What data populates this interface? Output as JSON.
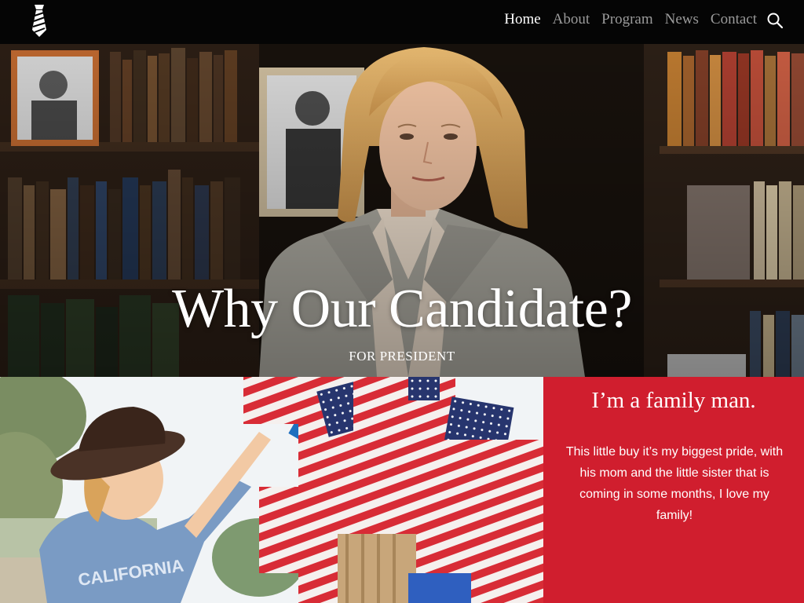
{
  "nav": {
    "items": [
      {
        "label": "Home",
        "active": true
      },
      {
        "label": "About",
        "active": false
      },
      {
        "label": "Program",
        "active": false
      },
      {
        "label": "News",
        "active": false
      },
      {
        "label": "Contact",
        "active": false
      }
    ],
    "logo_icon": "necktie-icon",
    "search_icon": "search-icon"
  },
  "hero": {
    "title": "Why Our Candidate?",
    "subtitle": "FOR PRESIDENT"
  },
  "feature": {
    "heading": "I’m a family man.",
    "text": "This little buy it’s my biggest pride, with his mom and the little sister that is coming in some months, I love my family!"
  },
  "photo_shirt_text": "CALIFORNIA",
  "colors": {
    "nav_bg": "#050505",
    "accent_red": "#d01e2e",
    "nav_active": "#ffffff",
    "nav_inactive": "#9a9a9a"
  }
}
